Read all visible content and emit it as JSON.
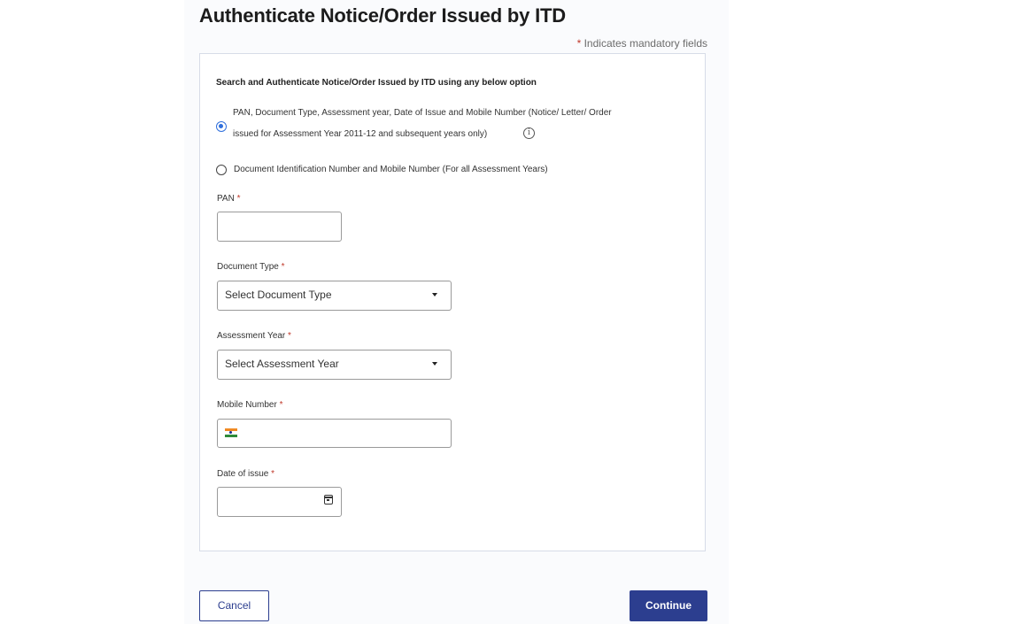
{
  "page": {
    "title": "Authenticate Notice/Order Issued by ITD",
    "mandatory_star": "*",
    "mandatory_note": "Indicates mandatory fields"
  },
  "form": {
    "search_heading": "Search and Authenticate Notice/Order Issued by ITD using any below option",
    "options": [
      {
        "line1": "PAN, Document Type, Assessment year, Date of Issue and Mobile Number (Notice/ Letter/ Order",
        "line2": "issued for Assessment Year 2011-12 and subsequent years only)",
        "selected": true
      },
      {
        "line1": "Document Identification Number and Mobile Number (For all Assessment Years)",
        "selected": false
      }
    ],
    "info_icon_glyph": "i",
    "required_star": "*",
    "pan": {
      "label": "PAN",
      "value": ""
    },
    "document_type": {
      "label": "Document Type",
      "selected": "Select Document Type"
    },
    "assessment_year": {
      "label": "Assessment Year",
      "selected": "Select Assessment Year"
    },
    "mobile": {
      "label": "Mobile Number",
      "value": "",
      "flag_icon": "india-flag-icon"
    },
    "date_of_issue": {
      "label": "Date of issue",
      "value": "",
      "icon": "calendar-icon"
    }
  },
  "actions": {
    "cancel_label": "Cancel",
    "continue_label": "Continue"
  },
  "colors": {
    "primary": "#2c3e8f",
    "radio_selected": "#2f6fdc",
    "required": "#c0392b",
    "border": "#d7dce8"
  }
}
